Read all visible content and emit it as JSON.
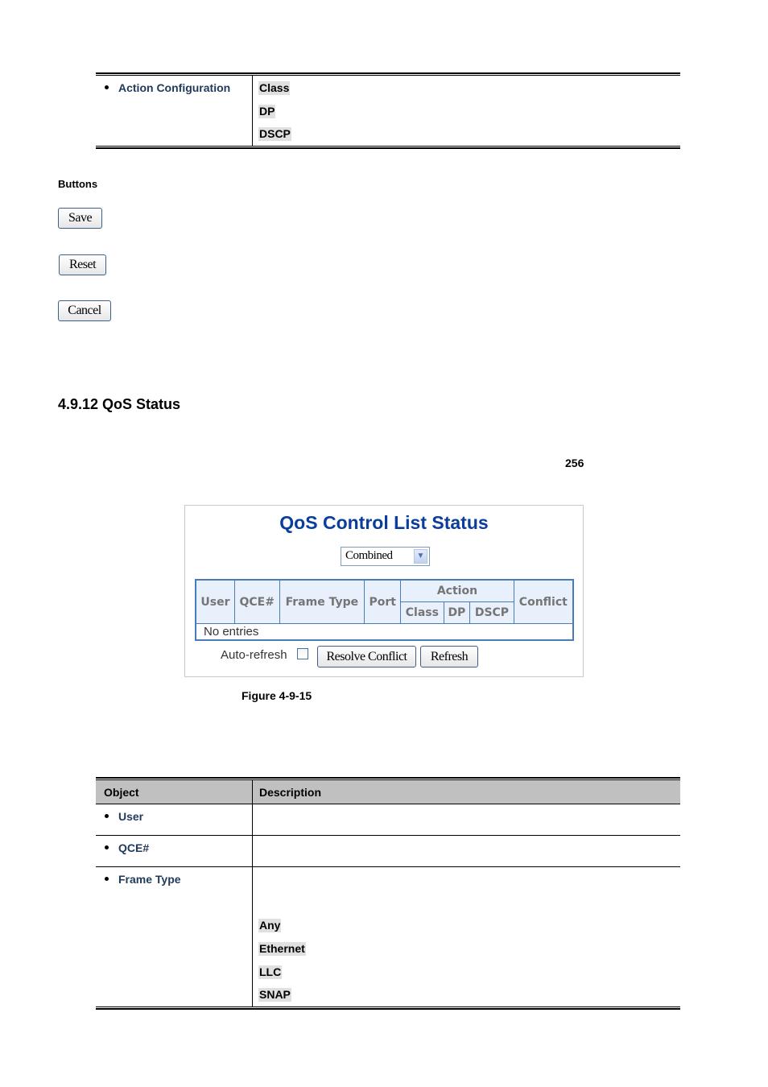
{
  "top_table": {
    "object_label": "Action Configuration",
    "values": [
      "Class",
      "DP",
      "DSCP"
    ]
  },
  "buttons_section": {
    "heading": "Buttons",
    "save": "Save",
    "reset": "Reset",
    "cancel": "Cancel"
  },
  "section": {
    "title": "4.9.12 QoS Status",
    "page_number": "256"
  },
  "screenshot": {
    "title": "QoS Control List Status",
    "select_value": "Combined",
    "table": {
      "headers": {
        "user": "User",
        "qce": "QCE#",
        "frame_type": "Frame Type",
        "port": "Port",
        "action": "Action",
        "class": "Class",
        "dp": "DP",
        "dscp": "DSCP",
        "conflict": "Conflict"
      },
      "empty_message": "No entries"
    },
    "auto_refresh_label": "Auto-refresh",
    "auto_refresh_checked": false,
    "resolve_conflict": "Resolve Conflict",
    "refresh": "Refresh",
    "colors": {
      "title": "#0a3d9c",
      "table_border": "#4a7ab8",
      "header_bg": "#e8f0fc"
    }
  },
  "figure_caption": "Figure 4-9-15",
  "object_table": {
    "headers": {
      "object": "Object",
      "description": "Description"
    },
    "rows": [
      {
        "object": "User",
        "values": []
      },
      {
        "object": "QCE#",
        "values": []
      },
      {
        "object": "Frame Type",
        "values": [
          "Any",
          "Ethernet",
          "LLC",
          "SNAP"
        ]
      }
    ]
  }
}
